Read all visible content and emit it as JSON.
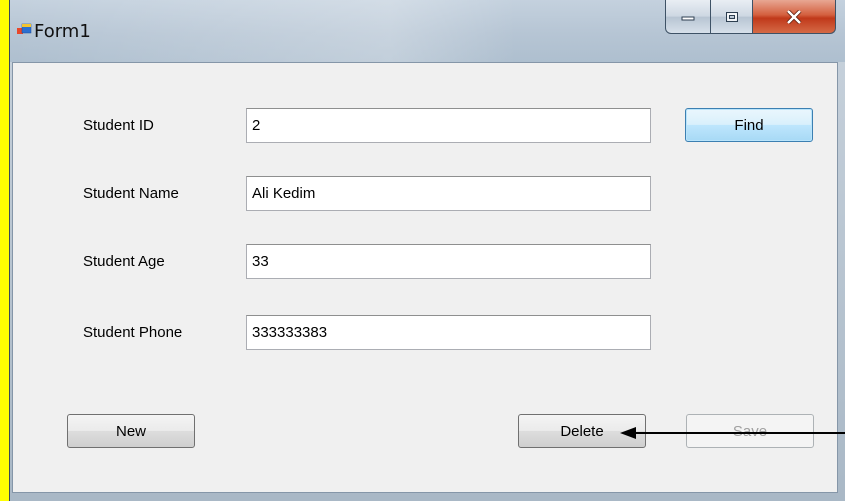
{
  "window": {
    "title": "Form1"
  },
  "form": {
    "fields": [
      {
        "label": "Student ID",
        "value": "2"
      },
      {
        "label": "Student Name",
        "value": "Ali Kedim"
      },
      {
        "label": "Student Age",
        "value": "33"
      },
      {
        "label": "Student Phone",
        "value": "333333383"
      }
    ],
    "buttons": {
      "find": "Find",
      "new": "New",
      "delete": "Delete",
      "save": "Save"
    }
  },
  "colors": {
    "backdrop": "#ffff00",
    "client_bg": "#f0f0f0",
    "close_button": "#c0391a"
  }
}
